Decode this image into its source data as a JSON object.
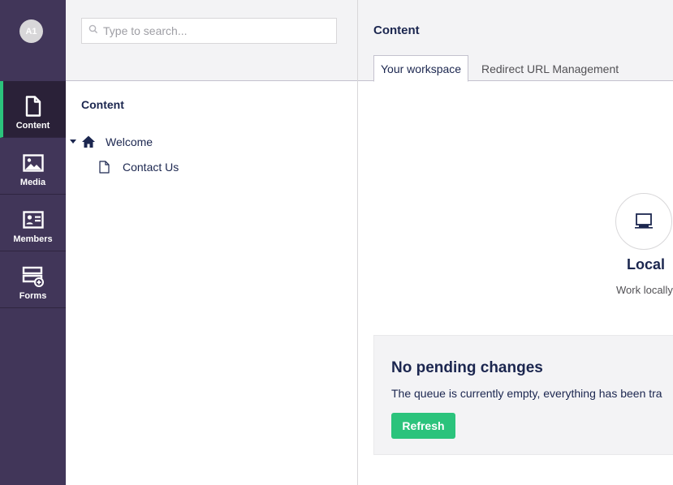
{
  "user": {
    "initials": "A1"
  },
  "sections": [
    {
      "label": "Content",
      "icon": "document-icon",
      "active": true
    },
    {
      "label": "Media",
      "icon": "image-icon",
      "active": false
    },
    {
      "label": "Members",
      "icon": "id-card-icon",
      "active": false
    },
    {
      "label": "Forms",
      "icon": "forms-icon",
      "active": false
    }
  ],
  "search": {
    "placeholder": "Type to search..."
  },
  "tree": {
    "title": "Content",
    "root": {
      "label": "Welcome",
      "icon": "home-icon",
      "expanded": true
    },
    "children": [
      {
        "label": "Contact Us",
        "icon": "document-icon"
      }
    ]
  },
  "editor": {
    "title": "Content",
    "tabs": [
      {
        "label": "Your workspace",
        "active": true
      },
      {
        "label": "Redirect URL Management",
        "active": false
      }
    ],
    "workspace": {
      "name": "Local",
      "description": "Work locally",
      "icon": "computer-icon"
    },
    "pending": {
      "title": "No pending changes",
      "text": "The queue is currently empty, everything has been tra",
      "button": "Refresh"
    }
  },
  "colors": {
    "rail": "#413659",
    "accent": "#2bc37c",
    "text": "#1b264f"
  }
}
